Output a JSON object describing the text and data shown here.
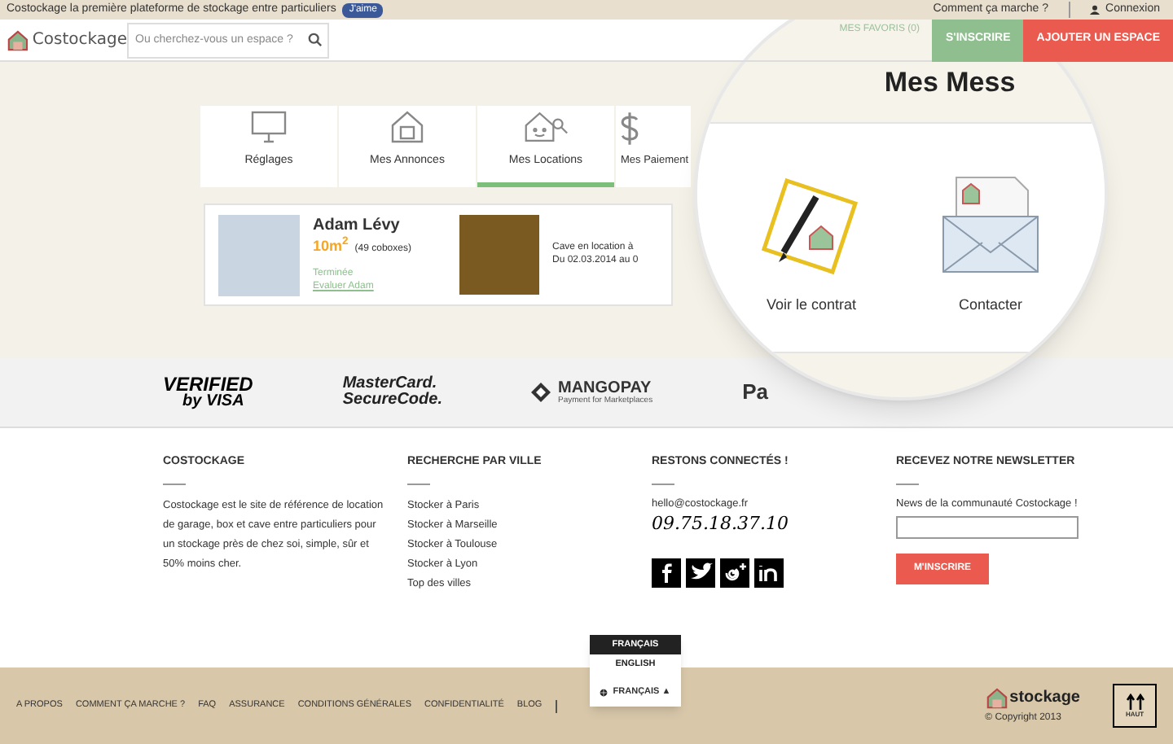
{
  "top_bar": {
    "tagline": "Costockage la première plateforme de stockage entre particuliers",
    "like_button": "J'aime",
    "links": [
      "Comment ça marche ?",
      "Connexion"
    ]
  },
  "header": {
    "logo": "Costockage",
    "search": {
      "placeholder": "Ou cherchez-vous un espace ?"
    },
    "favorites": "MES FAVORIS (0)",
    "buttons": [
      {
        "label": "S'INSCRIRE",
        "kind": "signup"
      },
      {
        "label": "AJOUTER UN ESPACE",
        "kind": "add"
      }
    ]
  },
  "tabs": [
    {
      "label": "Réglages",
      "kind": "monitor",
      "selected": false
    },
    {
      "label": "Mes Annonces",
      "kind": "house",
      "selected": false
    },
    {
      "label": "Mes Locations",
      "kind": "key",
      "selected": true
    },
    {
      "label": "Mes Paiement",
      "kind": "dollar",
      "selected": false
    }
  ],
  "rental": {
    "name": "Adam Lévy",
    "size": "10m$^{2}$",
    "coboxes": "(49 coboxes)",
    "status": "Terminée",
    "rate_link": "Evaluer Adam",
    "description": [
      "Cave en location à",
      "Du 02.03.2014 au 0"
    ]
  },
  "magnifier": {
    "title": "Mes Mess",
    "actions": [
      {
        "label": "Voir le contrat",
        "kind": "contract"
      },
      {
        "label": "Contacter",
        "kind": "mail"
      }
    ]
  },
  "payment_logos": [
    {
      "kind": "visa",
      "lines": [
        "VERIFIED",
        "by VISA"
      ]
    },
    {
      "kind": "mastercard",
      "lines": [
        "MasterCard.",
        "SecureCode."
      ]
    },
    {
      "kind": "mangopay",
      "lines": [
        "MANGOPAY",
        "Payment for Marketplaces"
      ]
    },
    {
      "kind": "partial",
      "lines": [
        "Pa"
      ]
    }
  ],
  "footer": {
    "about": {
      "title": "COSTOCKAGE",
      "text": "Costockage est le site de référence de location de garage, box et cave entre particuliers pour un stockage près de chez soi, simple, sûr et 50% moins cher."
    },
    "cities": {
      "title": "RECHERCHE PAR VILLE",
      "links": [
        "Stocker à Paris",
        "Stocker à Marseille",
        "Stocker à Toulouse",
        "Stocker à Lyon",
        "Top des villes"
      ]
    },
    "contact": {
      "title": "RESTONS CONNECTÉS !",
      "email": "hello@costockage.fr",
      "phone": "09.75.18.37.10"
    },
    "newsletter": {
      "title": "RECEVEZ NOTRE NEWSLETTER",
      "text": "News de la communauté Costockage !",
      "button": "M'INSCRIRE"
    }
  },
  "language_menu": {
    "options": [
      {
        "label": "FRANÇAIS",
        "selected": true
      },
      {
        "label": "ENGLISH",
        "selected": false
      }
    ],
    "current": "FRANÇAIS ▲"
  },
  "bottom_bar": {
    "links": [
      "A PROPOS",
      "COMMENT ÇA MARCHE ?",
      "FAQ",
      "ASSURANCE",
      "CONDITIONS GÉNÉRALES",
      "CONFIDENTIALITÉ",
      "BLOG"
    ],
    "logo": "stockage",
    "copyright": "© Copyright 2013",
    "top_button": "HAUT"
  }
}
